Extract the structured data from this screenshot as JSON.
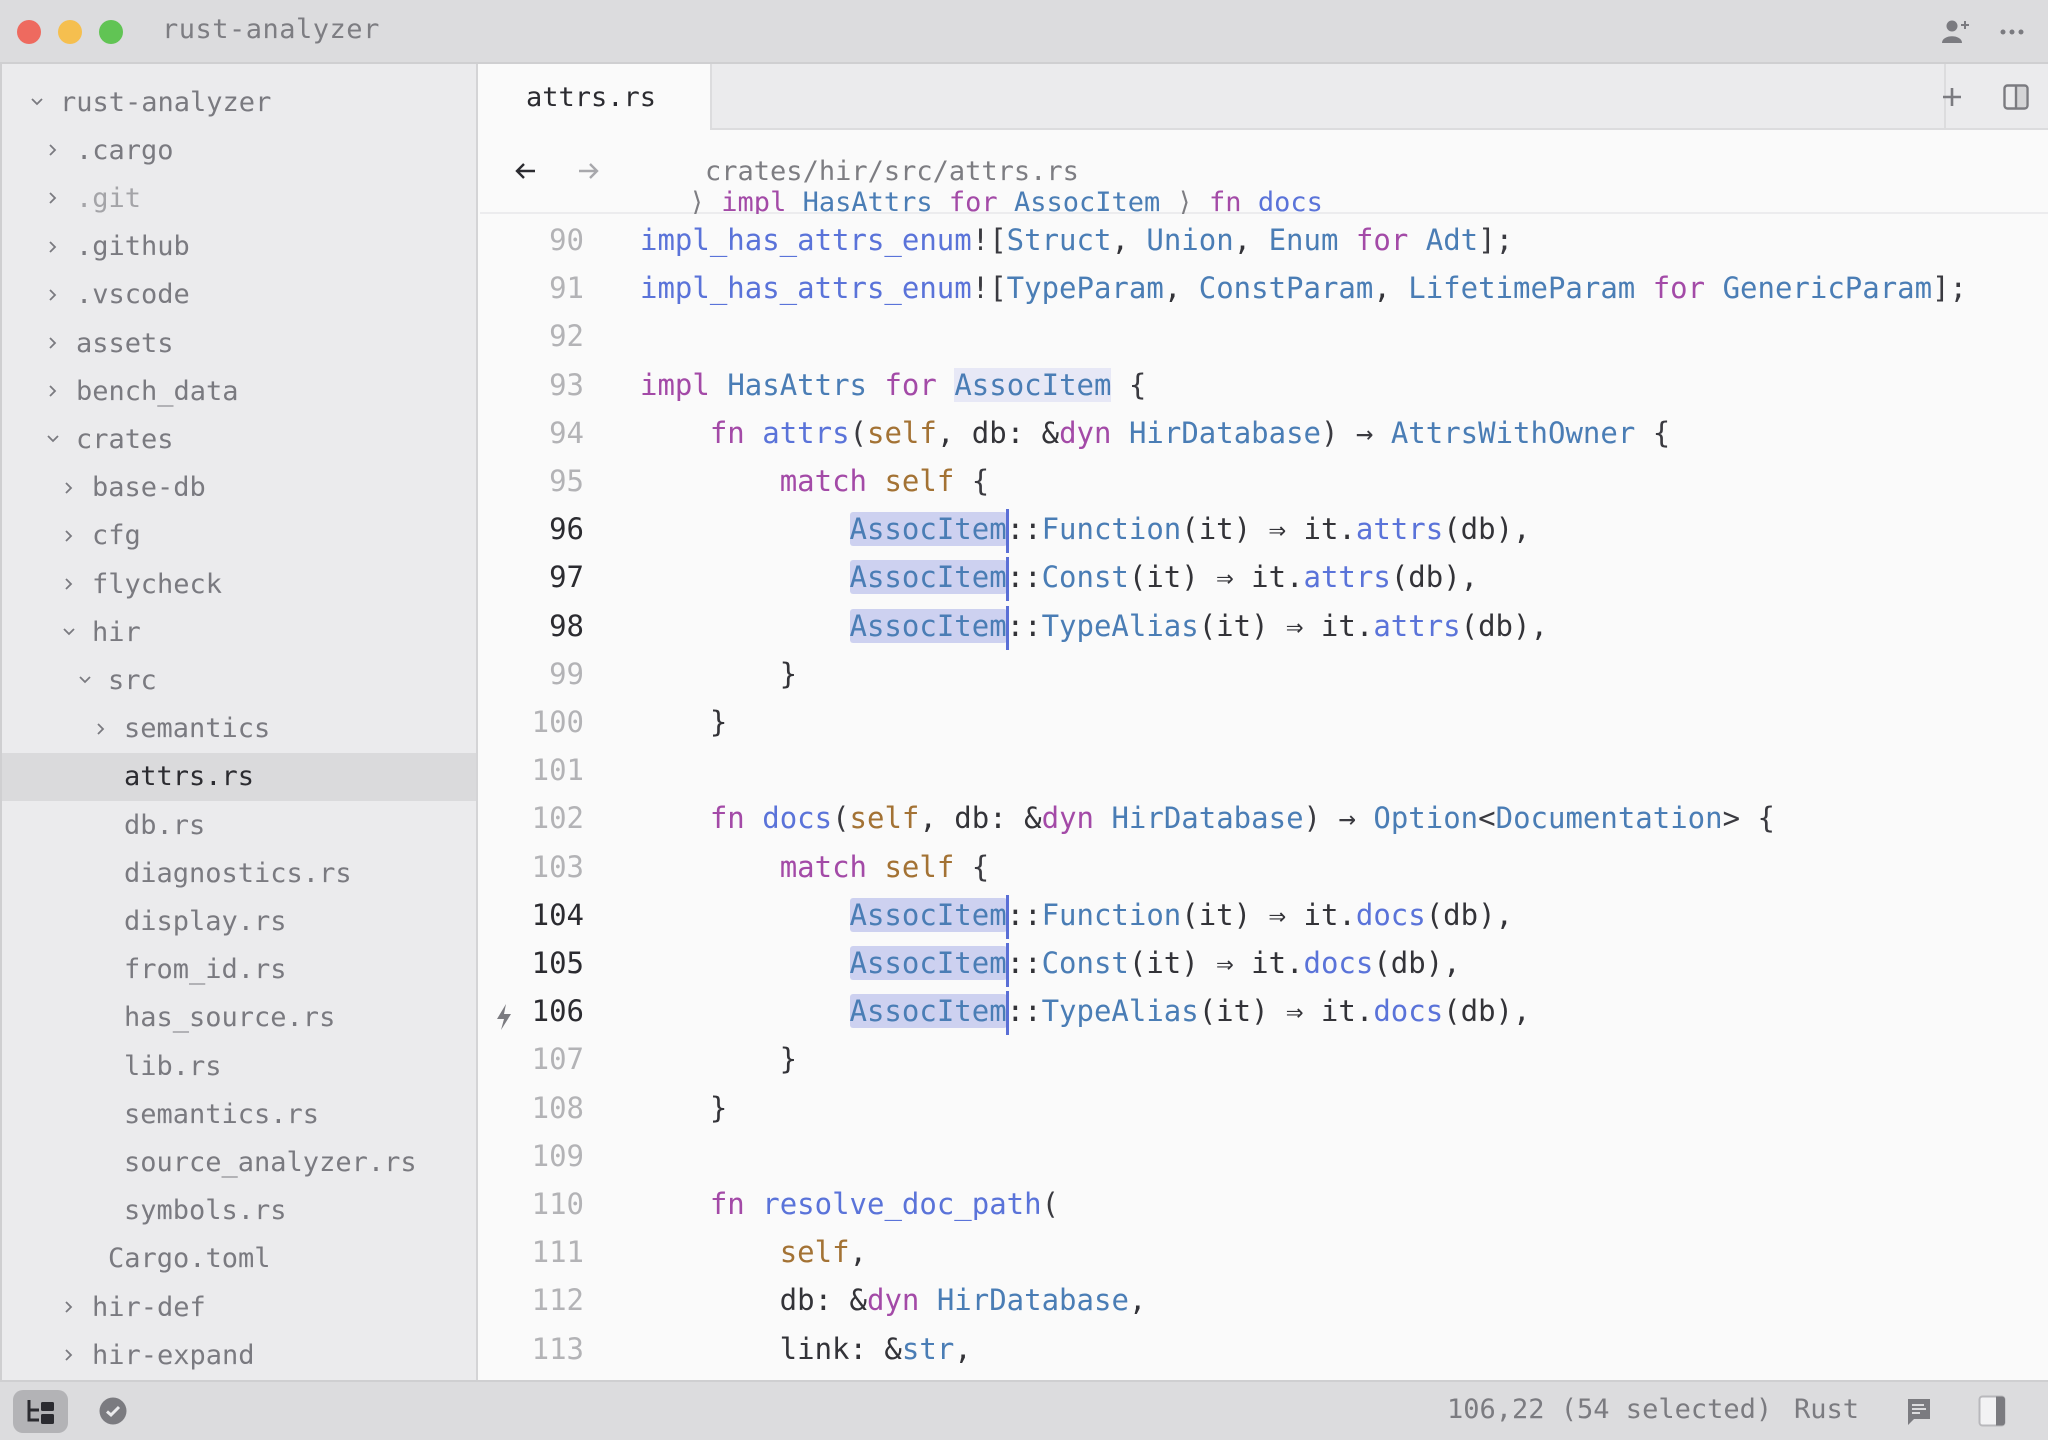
{
  "window": {
    "title": "rust-analyzer",
    "titlebar_icons": [
      "add-collaborator-icon",
      "more-options-icon"
    ]
  },
  "sidebar": {
    "items": [
      {
        "label": "rust-analyzer",
        "depth": 0,
        "kind": "folder",
        "expanded": true
      },
      {
        "label": ".cargo",
        "depth": 1,
        "kind": "folder",
        "expanded": false
      },
      {
        "label": ".git",
        "depth": 1,
        "kind": "folder",
        "expanded": false,
        "dim": true
      },
      {
        "label": ".github",
        "depth": 1,
        "kind": "folder",
        "expanded": false
      },
      {
        "label": ".vscode",
        "depth": 1,
        "kind": "folder",
        "expanded": false
      },
      {
        "label": "assets",
        "depth": 1,
        "kind": "folder",
        "expanded": false
      },
      {
        "label": "bench_data",
        "depth": 1,
        "kind": "folder",
        "expanded": false
      },
      {
        "label": "crates",
        "depth": 1,
        "kind": "folder",
        "expanded": true
      },
      {
        "label": "base-db",
        "depth": 2,
        "kind": "folder",
        "expanded": false
      },
      {
        "label": "cfg",
        "depth": 2,
        "kind": "folder",
        "expanded": false
      },
      {
        "label": "flycheck",
        "depth": 2,
        "kind": "folder",
        "expanded": false
      },
      {
        "label": "hir",
        "depth": 2,
        "kind": "folder",
        "expanded": true
      },
      {
        "label": "src",
        "depth": 3,
        "kind": "folder",
        "expanded": true
      },
      {
        "label": "semantics",
        "depth": 4,
        "kind": "folder",
        "expanded": false
      },
      {
        "label": "attrs.rs",
        "depth": 4,
        "kind": "file",
        "selected": true
      },
      {
        "label": "db.rs",
        "depth": 4,
        "kind": "file"
      },
      {
        "label": "diagnostics.rs",
        "depth": 4,
        "kind": "file"
      },
      {
        "label": "display.rs",
        "depth": 4,
        "kind": "file"
      },
      {
        "label": "from_id.rs",
        "depth": 4,
        "kind": "file"
      },
      {
        "label": "has_source.rs",
        "depth": 4,
        "kind": "file"
      },
      {
        "label": "lib.rs",
        "depth": 4,
        "kind": "file"
      },
      {
        "label": "semantics.rs",
        "depth": 4,
        "kind": "file"
      },
      {
        "label": "source_analyzer.rs",
        "depth": 4,
        "kind": "file"
      },
      {
        "label": "symbols.rs",
        "depth": 4,
        "kind": "file"
      },
      {
        "label": "Cargo.toml",
        "depth": 3,
        "kind": "file"
      },
      {
        "label": "hir-def",
        "depth": 2,
        "kind": "folder",
        "expanded": false
      },
      {
        "label": "hir-expand",
        "depth": 2,
        "kind": "folder",
        "expanded": false
      }
    ]
  },
  "tabs": [
    {
      "label": "attrs.rs",
      "active": true
    }
  ],
  "tabbar_actions": [
    "new-tab-icon",
    "split-pane-icon"
  ],
  "breadcrumb": {
    "path": "crates/hir/src/attrs.rs",
    "separator": "〉",
    "symbols": [
      [
        {
          "t": "impl",
          "c": "kw"
        },
        {
          "t": " "
        },
        {
          "t": "HasAttrs",
          "c": "ty"
        },
        {
          "t": " "
        },
        {
          "t": "for",
          "c": "kw"
        },
        {
          "t": " "
        },
        {
          "t": "AssocItem",
          "c": "ty"
        }
      ],
      [
        {
          "t": "fn",
          "c": "kw"
        },
        {
          "t": " "
        },
        {
          "t": "docs",
          "c": "fn"
        }
      ]
    ]
  },
  "editor": {
    "active_lines": [
      96,
      97,
      98,
      104,
      105,
      106
    ],
    "code_action_line": 106,
    "lines": [
      {
        "n": 90,
        "tokens": [
          {
            "t": "impl_has_attrs_enum",
            "c": "fn"
          },
          {
            "t": "!",
            "c": "pn"
          },
          {
            "t": "[",
            "c": "pn"
          },
          {
            "t": "Struct",
            "c": "ty"
          },
          {
            "t": ", "
          },
          {
            "t": "Union",
            "c": "ty"
          },
          {
            "t": ", "
          },
          {
            "t": "Enum",
            "c": "ty"
          },
          {
            "t": " "
          },
          {
            "t": "for",
            "c": "kw"
          },
          {
            "t": " "
          },
          {
            "t": "Adt",
            "c": "ty"
          },
          {
            "t": "];",
            "c": "pn"
          }
        ]
      },
      {
        "n": 91,
        "tokens": [
          {
            "t": "impl_has_attrs_enum",
            "c": "fn"
          },
          {
            "t": "!",
            "c": "pn"
          },
          {
            "t": "[",
            "c": "pn"
          },
          {
            "t": "TypeParam",
            "c": "ty"
          },
          {
            "t": ", "
          },
          {
            "t": "ConstParam",
            "c": "ty"
          },
          {
            "t": ", "
          },
          {
            "t": "LifetimeParam",
            "c": "ty"
          },
          {
            "t": " "
          },
          {
            "t": "for",
            "c": "kw"
          },
          {
            "t": " "
          },
          {
            "t": "GenericParam",
            "c": "ty"
          },
          {
            "t": "];",
            "c": "pn"
          }
        ]
      },
      {
        "n": 92,
        "tokens": []
      },
      {
        "n": 93,
        "tokens": [
          {
            "t": "impl",
            "c": "kw"
          },
          {
            "t": " "
          },
          {
            "t": "HasAttrs",
            "c": "ty"
          },
          {
            "t": " "
          },
          {
            "t": "for",
            "c": "kw"
          },
          {
            "t": " "
          },
          {
            "t": "AssocItem",
            "c": "ty",
            "hl": "ref"
          },
          {
            "t": " {",
            "c": "pn"
          }
        ]
      },
      {
        "n": 94,
        "tokens": [
          {
            "t": "    "
          },
          {
            "t": "fn",
            "c": "kw"
          },
          {
            "t": " "
          },
          {
            "t": "attrs",
            "c": "fn"
          },
          {
            "t": "(",
            "c": "pn"
          },
          {
            "t": "self",
            "c": "sf"
          },
          {
            "t": ", db: &"
          },
          {
            "t": "dyn",
            "c": "kw"
          },
          {
            "t": " "
          },
          {
            "t": "HirDatabase",
            "c": "ty"
          },
          {
            "t": ") → ",
            "c": "pn"
          },
          {
            "t": "AttrsWithOwner",
            "c": "ty"
          },
          {
            "t": " {",
            "c": "pn"
          }
        ]
      },
      {
        "n": 95,
        "tokens": [
          {
            "t": "        "
          },
          {
            "t": "match",
            "c": "kw"
          },
          {
            "t": " "
          },
          {
            "t": "self",
            "c": "sf"
          },
          {
            "t": " {",
            "c": "pn"
          }
        ]
      },
      {
        "n": 96,
        "tokens": [
          {
            "t": "            "
          },
          {
            "t": "AssocItem",
            "c": "ty",
            "hl": "sel"
          },
          {
            "t": "",
            "cursor": true
          },
          {
            "t": "::"
          },
          {
            "t": "Function",
            "c": "ty"
          },
          {
            "t": "(it) ⇒ it."
          },
          {
            "t": "attrs",
            "c": "fn"
          },
          {
            "t": "(db),"
          }
        ]
      },
      {
        "n": 97,
        "tokens": [
          {
            "t": "            "
          },
          {
            "t": "AssocItem",
            "c": "ty",
            "hl": "sel"
          },
          {
            "t": "",
            "cursor": true
          },
          {
            "t": "::"
          },
          {
            "t": "Const",
            "c": "ty"
          },
          {
            "t": "(it) ⇒ it."
          },
          {
            "t": "attrs",
            "c": "fn"
          },
          {
            "t": "(db),"
          }
        ]
      },
      {
        "n": 98,
        "tokens": [
          {
            "t": "            "
          },
          {
            "t": "AssocItem",
            "c": "ty",
            "hl": "sel"
          },
          {
            "t": "",
            "cursor": true
          },
          {
            "t": "::"
          },
          {
            "t": "TypeAlias",
            "c": "ty"
          },
          {
            "t": "(it) ⇒ it."
          },
          {
            "t": "attrs",
            "c": "fn"
          },
          {
            "t": "(db),"
          }
        ]
      },
      {
        "n": 99,
        "tokens": [
          {
            "t": "        }"
          }
        ]
      },
      {
        "n": 100,
        "tokens": [
          {
            "t": "    }"
          }
        ]
      },
      {
        "n": 101,
        "tokens": []
      },
      {
        "n": 102,
        "tokens": [
          {
            "t": "    "
          },
          {
            "t": "fn",
            "c": "kw"
          },
          {
            "t": " "
          },
          {
            "t": "docs",
            "c": "fn"
          },
          {
            "t": "(",
            "c": "pn"
          },
          {
            "t": "self",
            "c": "sf"
          },
          {
            "t": ", db: &"
          },
          {
            "t": "dyn",
            "c": "kw"
          },
          {
            "t": " "
          },
          {
            "t": "HirDatabase",
            "c": "ty"
          },
          {
            "t": ") → ",
            "c": "pn"
          },
          {
            "t": "Option",
            "c": "ty"
          },
          {
            "t": "<",
            "c": "pn"
          },
          {
            "t": "Documentation",
            "c": "ty"
          },
          {
            "t": "> {",
            "c": "pn"
          }
        ]
      },
      {
        "n": 103,
        "tokens": [
          {
            "t": "        "
          },
          {
            "t": "match",
            "c": "kw"
          },
          {
            "t": " "
          },
          {
            "t": "self",
            "c": "sf"
          },
          {
            "t": " {",
            "c": "pn"
          }
        ]
      },
      {
        "n": 104,
        "tokens": [
          {
            "t": "            "
          },
          {
            "t": "AssocItem",
            "c": "ty",
            "hl": "sel"
          },
          {
            "t": "",
            "cursor": true
          },
          {
            "t": "::"
          },
          {
            "t": "Function",
            "c": "ty"
          },
          {
            "t": "(it) ⇒ it."
          },
          {
            "t": "docs",
            "c": "fn"
          },
          {
            "t": "(db),"
          }
        ]
      },
      {
        "n": 105,
        "tokens": [
          {
            "t": "            "
          },
          {
            "t": "AssocItem",
            "c": "ty",
            "hl": "sel"
          },
          {
            "t": "",
            "cursor": true
          },
          {
            "t": "::"
          },
          {
            "t": "Const",
            "c": "ty"
          },
          {
            "t": "(it) ⇒ it."
          },
          {
            "t": "docs",
            "c": "fn"
          },
          {
            "t": "(db),"
          }
        ]
      },
      {
        "n": 106,
        "tokens": [
          {
            "t": "            "
          },
          {
            "t": "AssocItem",
            "c": "ty",
            "hl": "sel"
          },
          {
            "t": "",
            "cursor": true
          },
          {
            "t": "::"
          },
          {
            "t": "TypeAlias",
            "c": "ty"
          },
          {
            "t": "(it) ⇒ it."
          },
          {
            "t": "docs",
            "c": "fn"
          },
          {
            "t": "(db),"
          }
        ]
      },
      {
        "n": 107,
        "tokens": [
          {
            "t": "        }"
          }
        ]
      },
      {
        "n": 108,
        "tokens": [
          {
            "t": "    }"
          }
        ]
      },
      {
        "n": 109,
        "tokens": []
      },
      {
        "n": 110,
        "tokens": [
          {
            "t": "    "
          },
          {
            "t": "fn",
            "c": "kw"
          },
          {
            "t": " "
          },
          {
            "t": "resolve_doc_path",
            "c": "fn"
          },
          {
            "t": "(",
            "c": "pn"
          }
        ]
      },
      {
        "n": 111,
        "tokens": [
          {
            "t": "        "
          },
          {
            "t": "self",
            "c": "sf"
          },
          {
            "t": ","
          }
        ]
      },
      {
        "n": 112,
        "tokens": [
          {
            "t": "        db: &"
          },
          {
            "t": "dyn",
            "c": "kw"
          },
          {
            "t": " "
          },
          {
            "t": "HirDatabase",
            "c": "ty"
          },
          {
            "t": ","
          }
        ]
      },
      {
        "n": 113,
        "tokens": [
          {
            "t": "        link: &"
          },
          {
            "t": "str",
            "c": "ty"
          },
          {
            "t": ","
          }
        ]
      }
    ]
  },
  "statusbar": {
    "cursor_position": "106,22 (54 selected)",
    "language": "Rust",
    "left_icons": [
      "project-panel-icon",
      "diagnostics-ok-icon"
    ],
    "right_icons": [
      "feedback-icon",
      "toggle-right-dock-icon"
    ]
  },
  "colors": {
    "keyword": "#a34aa7",
    "type": "#4a7db5",
    "function": "#5a73d9",
    "self": "#a37234",
    "selection": "#cdd1f0",
    "cursor": "#5a6fd6"
  }
}
